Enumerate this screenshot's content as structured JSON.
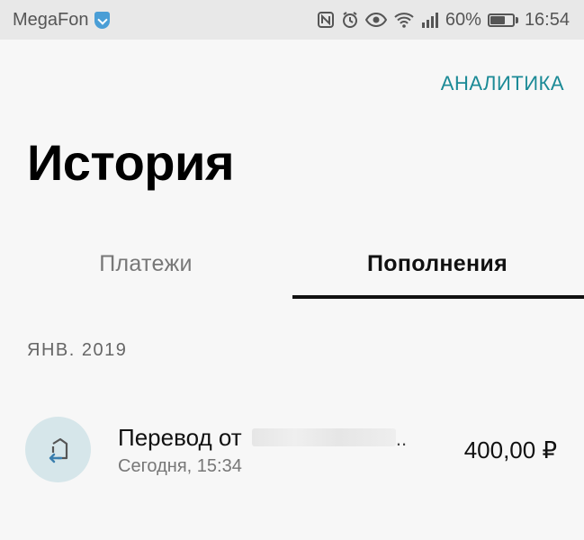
{
  "status_bar": {
    "carrier": "MegaFon",
    "battery": "60%",
    "time": "16:54",
    "icons": [
      "nfc-icon",
      "alarm-icon",
      "eye-icon",
      "wifi-icon",
      "signal-icon",
      "battery-icon"
    ]
  },
  "header": {
    "analytics_label": "АНАЛИТИКА",
    "title": "История"
  },
  "tabs": [
    {
      "label": "Платежи",
      "active": false
    },
    {
      "label": "Пополнения",
      "active": true
    }
  ],
  "section": {
    "month": "ЯНВ. 2019"
  },
  "operations": [
    {
      "title": "Перевод от",
      "ellipsis": "..",
      "date": "Сегодня, 15:34",
      "amount": "400,00 ₽",
      "icon": "incoming-transfer-icon"
    }
  ],
  "colors": {
    "accent": "#1b8a96",
    "background": "#f7f7f7",
    "status_bar": "#e8e8e8",
    "icon_circle": "#d6e6ea"
  }
}
